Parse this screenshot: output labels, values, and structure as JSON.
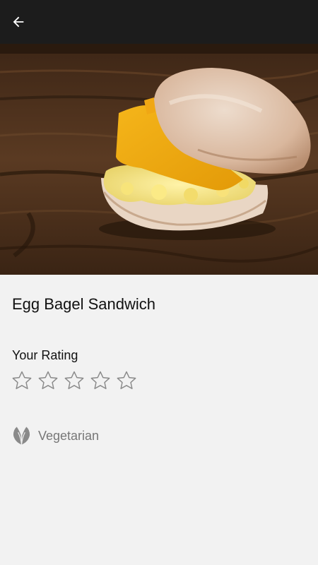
{
  "header": {
    "back_icon": "arrow-left-icon",
    "background_color": "#1c1c1c"
  },
  "hero_image": {
    "subject": "egg and cheese bagel sandwich on wooden table"
  },
  "item": {
    "title": "Egg Bagel Sandwich"
  },
  "rating": {
    "label": "Your Rating",
    "max_stars": 5,
    "value": 0,
    "star_icon": "star-outline-icon"
  },
  "dietary": {
    "icon": "vegetarian-leaf-icon",
    "label": "Vegetarian"
  },
  "colors": {
    "page_background": "#f2f2f2",
    "muted_text": "#777777",
    "star_outline": "#8a8a8a"
  }
}
